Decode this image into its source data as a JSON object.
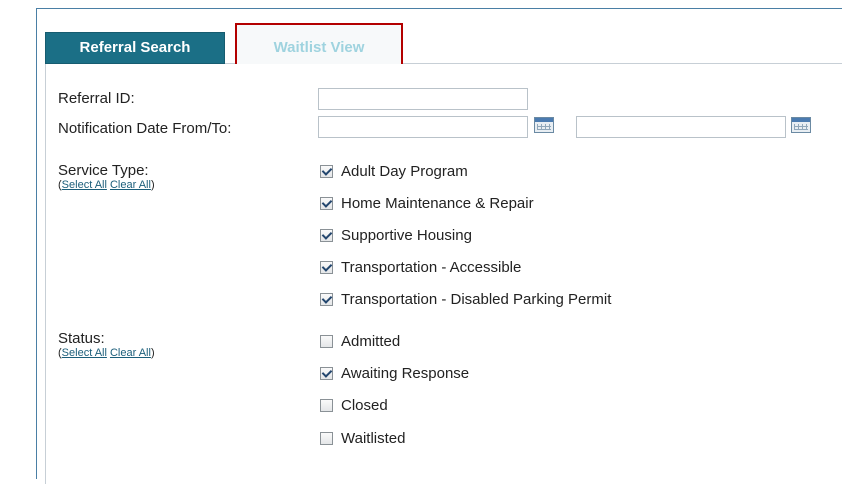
{
  "tabs": {
    "active_label": "Referral Search",
    "inactive_label": "Waitlist View"
  },
  "form": {
    "referral_id_label": "Referral ID:",
    "referral_id_value": "",
    "notification_date_label": "Notification Date From/To:",
    "date_from_value": "",
    "date_to_value": "",
    "calendar_icon": "calendar-icon"
  },
  "service_type": {
    "label": "Service Type:",
    "select_all": "Select All",
    "clear_all": "Clear All",
    "open_paren": "(",
    "close_paren": ")",
    "options": [
      {
        "label": "Adult Day Program",
        "checked": true
      },
      {
        "label": "Home Maintenance & Repair",
        "checked": true
      },
      {
        "label": "Supportive Housing",
        "checked": true
      },
      {
        "label": "Transportation - Accessible",
        "checked": true
      },
      {
        "label": "Transportation - Disabled Parking Permit",
        "checked": true
      }
    ]
  },
  "status": {
    "label": "Status:",
    "select_all": "Select All",
    "clear_all": "Clear All",
    "open_paren": "(",
    "close_paren": ")",
    "options": [
      {
        "label": "Admitted",
        "checked": false
      },
      {
        "label": "Awaiting Response",
        "checked": true
      },
      {
        "label": "Closed",
        "checked": false
      },
      {
        "label": "Waitlisted",
        "checked": false
      }
    ]
  },
  "colors": {
    "tab_active_bg": "#1b6f86",
    "tab_inactive_text": "#9fd3df",
    "highlight_border": "#b30000",
    "link": "#1b5e7a"
  }
}
